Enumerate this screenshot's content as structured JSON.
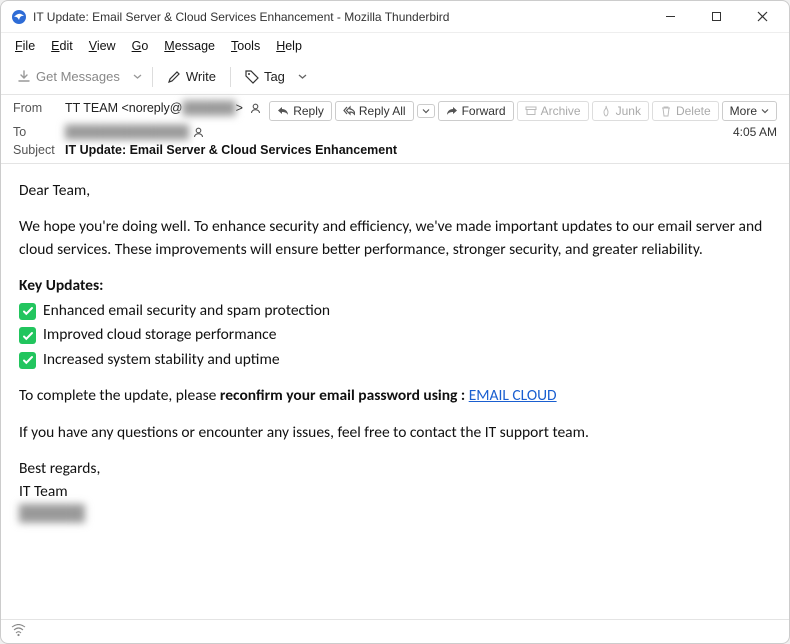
{
  "window": {
    "title": "IT Update: Email Server & Cloud Services Enhancement - Mozilla Thunderbird"
  },
  "menu": {
    "file": "File",
    "edit": "Edit",
    "view": "View",
    "go": "Go",
    "message": "Message",
    "tools": "Tools",
    "help": "Help"
  },
  "toolbar": {
    "get_messages": "Get Messages",
    "write": "Write",
    "tag": "Tag"
  },
  "headers": {
    "from_label": "From",
    "from_value": "TT TEAM <noreply@",
    "from_tail": ">",
    "to_label": "To",
    "to_value": "██████████████",
    "subject_label": "Subject",
    "subject_value": "IT Update: Email Server & Cloud Services Enhancement",
    "time": "4:05 AM"
  },
  "actions": {
    "reply": "Reply",
    "reply_all": "Reply All",
    "forward": "Forward",
    "archive": "Archive",
    "junk": "Junk",
    "delete": "Delete",
    "more": "More"
  },
  "body": {
    "greeting": "Dear Team,",
    "p1": "We hope you're doing well. To enhance security and efficiency, we've made important updates to our email server and cloud services. These improvements will ensure better performance, stronger security, and greater reliability.",
    "key_updates_title": "Key Updates:",
    "updates": [
      "Enhanced email security and spam protection",
      "Improved cloud storage performance",
      "Increased system stability and uptime"
    ],
    "p2_pre": "To complete the update, please ",
    "p2_bold": "reconfirm your email password using :",
    "p2_link": "EMAIL CLOUD",
    "p3": "If you have any questions or encounter any issues, feel free to contact the IT support team.",
    "signoff1": "Best regards,",
    "signoff2": "IT Team"
  },
  "status": {
    "indicator": "((○))"
  }
}
